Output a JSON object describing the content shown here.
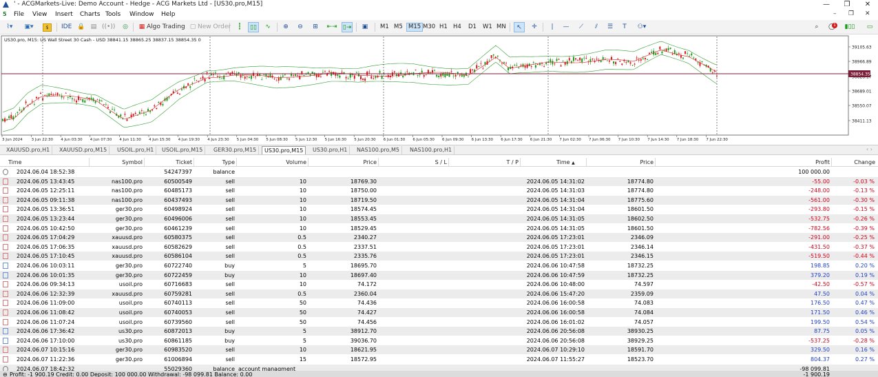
{
  "window": {
    "title": "' - ACGMarkets-Live: Demo Account - Hedge - ACG Markets Ltd - [US30.pro,M15]",
    "minimize": "—",
    "maximize": "❐",
    "close": "✕"
  },
  "menu": [
    "File",
    "View",
    "Insert",
    "Charts",
    "Tools",
    "Window",
    "Help"
  ],
  "toolbar": {
    "ide_label": "IDE",
    "algo_label": "Algo Trading",
    "new_order_label": "New Order",
    "timeframes": [
      "M1",
      "M5",
      "M15",
      "M30",
      "H1",
      "H4",
      "D1",
      "W1",
      "MN"
    ],
    "active_timeframe": "M15",
    "notification_count": "1"
  },
  "chart": {
    "header": "US30.pro, M15:  US Wall Street 30 Cash - USD  38841.15 38865.25 38837.15 38854.35  0",
    "current_price": "38854.35",
    "price_labels": [
      "39105.63",
      "38966.89",
      "38828.17",
      "38689.01",
      "38550.07",
      "38411.13"
    ],
    "time_labels": [
      "3 Jun 2024",
      "3 Jun 22:30",
      "4 Jun 03:30",
      "4 Jun 07:30",
      "4 Jun 11:30",
      "4 Jun 15:30",
      "4 Jun 19:30",
      "4 Jun 23:30",
      "5 Jun 04:30",
      "5 Jun 08:30",
      "5 Jun 12:30",
      "5 Jun 16:30",
      "5 Jun 20:30",
      "6 Jun 01:30",
      "6 Jun 05:30",
      "6 Jun 09:30",
      "6 Jun 13:30",
      "6 Jun 17:30",
      "6 Jun 21:30",
      "7 Jun 02:30",
      "7 Jun 06:30",
      "7 Jun 10:30",
      "7 Jun 14:30",
      "7 Jun 18:30",
      "7 Jun 22:30"
    ],
    "colors": {
      "bull": "#1a9b1a",
      "bear": "#d31a1a",
      "band": "#2e9d2e",
      "price_line": "#7a1f3a"
    }
  },
  "chart_tabs": [
    "XAUUSD.pro,H1",
    "XAUUSD.pro,M15",
    "USOIL.pro,H1",
    "USOIL.pro,M15",
    "GER30.pro,M15",
    "US30.pro,M15",
    "US30.pro,H1",
    "NAS100.pro,M5",
    "NAS100.pro,H1"
  ],
  "active_chart_tab": "US30.pro,M15",
  "history": {
    "headers": {
      "time": "Time",
      "symbol": "Symbol",
      "ticket": "Ticket",
      "type": "Type",
      "volume": "Volume",
      "price": "Price",
      "sl": "S / L",
      "tp": "T / P",
      "close_time": "Time",
      "close_price": "Price",
      "profit": "Profit",
      "change": "Change"
    },
    "sort_marker": "▲",
    "rows": [
      {
        "kind": "balance",
        "time": "2024.06.04 18:52:38",
        "symbol": "",
        "ticket": "54247397",
        "type": "balance",
        "volume": "",
        "price": "",
        "close_time": "",
        "close_price": "",
        "profit": "100 000.00",
        "change": ""
      },
      {
        "kind": "sell",
        "time": "2024.06.05 13:43:45",
        "symbol": "nas100.pro",
        "ticket": "60500549",
        "type": "sell",
        "volume": "10",
        "price": "18769.30",
        "close_time": "2024.06.05 14:31:02",
        "close_price": "18774.80",
        "profit": "-55.00",
        "change": "-0.03 %"
      },
      {
        "kind": "sell",
        "time": "2024.06.05 12:25:11",
        "symbol": "nas100.pro",
        "ticket": "60485173",
        "type": "sell",
        "volume": "10",
        "price": "18750.00",
        "close_time": "2024.06.05 14:31:03",
        "close_price": "18774.80",
        "profit": "-248.00",
        "change": "-0.13 %"
      },
      {
        "kind": "sell",
        "time": "2024.06.05 09:11:38",
        "symbol": "nas100.pro",
        "ticket": "60437493",
        "type": "sell",
        "volume": "10",
        "price": "18719.50",
        "close_time": "2024.06.05 14:31:04",
        "close_price": "18775.60",
        "profit": "-561.00",
        "change": "-0.30 %"
      },
      {
        "kind": "sell",
        "time": "2024.06.05 13:36:51",
        "symbol": "ger30.pro",
        "ticket": "60498924",
        "type": "sell",
        "volume": "10",
        "price": "18574.45",
        "close_time": "2024.06.05 14:31:04",
        "close_price": "18601.50",
        "profit": "-293.80",
        "change": "-0.15 %"
      },
      {
        "kind": "sell",
        "time": "2024.06.05 13:23:44",
        "symbol": "ger30.pro",
        "ticket": "60496006",
        "type": "sell",
        "volume": "10",
        "price": "18553.45",
        "close_time": "2024.06.05 14:31:05",
        "close_price": "18602.50",
        "profit": "-532.75",
        "change": "-0.26 %"
      },
      {
        "kind": "sell",
        "time": "2024.06.05 10:42:50",
        "symbol": "ger30.pro",
        "ticket": "60461239",
        "type": "sell",
        "volume": "10",
        "price": "18529.45",
        "close_time": "2024.06.05 14:31:05",
        "close_price": "18601.50",
        "profit": "-782.56",
        "change": "-0.39 %"
      },
      {
        "kind": "sell",
        "time": "2024.06.05 17:04:29",
        "symbol": "xauusd.pro",
        "ticket": "60580375",
        "type": "sell",
        "volume": "0.5",
        "price": "2340.27",
        "close_time": "2024.06.05 17:23:01",
        "close_price": "2346.09",
        "profit": "-291.00",
        "change": "-0.25 %"
      },
      {
        "kind": "sell",
        "time": "2024.06.05 17:06:35",
        "symbol": "xauusd.pro",
        "ticket": "60582629",
        "type": "sell",
        "volume": "0.5",
        "price": "2337.51",
        "close_time": "2024.06.05 17:23:01",
        "close_price": "2346.14",
        "profit": "-431.50",
        "change": "-0.37 %"
      },
      {
        "kind": "sell",
        "time": "2024.06.05 17:10:45",
        "symbol": "xauusd.pro",
        "ticket": "60586104",
        "type": "sell",
        "volume": "0.5",
        "price": "2335.76",
        "close_time": "2024.06.05 17:23:01",
        "close_price": "2346.15",
        "profit": "-519.50",
        "change": "-0.44 %"
      },
      {
        "kind": "buy",
        "time": "2024.06.06 10:03:11",
        "symbol": "ger30.pro",
        "ticket": "60722740",
        "type": "buy",
        "volume": "5",
        "price": "18695.70",
        "close_time": "2024.06.06 10:47:58",
        "close_price": "18732.25",
        "profit": "198.85",
        "change": "0.20 %"
      },
      {
        "kind": "buy",
        "time": "2024.06.06 10:01:35",
        "symbol": "ger30.pro",
        "ticket": "60722459",
        "type": "buy",
        "volume": "10",
        "price": "18697.40",
        "close_time": "2024.06.06 10:47:59",
        "close_price": "18732.25",
        "profit": "379.20",
        "change": "0.19 %"
      },
      {
        "kind": "sell",
        "time": "2024.06.06 09:34:13",
        "symbol": "usoil.pro",
        "ticket": "60716683",
        "type": "sell",
        "volume": "10",
        "price": "74.172",
        "close_time": "2024.06.06 10:48:00",
        "close_price": "74.597",
        "profit": "-42.50",
        "change": "-0.57 %"
      },
      {
        "kind": "sell",
        "time": "2024.06.06 12:32:39",
        "symbol": "xauusd.pro",
        "ticket": "60759281",
        "type": "sell",
        "volume": "0.5",
        "price": "2360.04",
        "close_time": "2024.06.06 15:47:20",
        "close_price": "2359.09",
        "profit": "47.50",
        "change": "0.04 %"
      },
      {
        "kind": "sell",
        "time": "2024.06.06 11:09:00",
        "symbol": "usoil.pro",
        "ticket": "60740113",
        "type": "sell",
        "volume": "50",
        "price": "74.436",
        "close_time": "2024.06.06 16:00:58",
        "close_price": "74.083",
        "profit": "176.50",
        "change": "0.47 %"
      },
      {
        "kind": "sell",
        "time": "2024.06.06 11:08:42",
        "symbol": "usoil.pro",
        "ticket": "60740053",
        "type": "sell",
        "volume": "50",
        "price": "74.427",
        "close_time": "2024.06.06 16:00:58",
        "close_price": "74.084",
        "profit": "171.50",
        "change": "0.46 %"
      },
      {
        "kind": "sell",
        "time": "2024.06.06 11:07:24",
        "symbol": "usoil.pro",
        "ticket": "60739560",
        "type": "sell",
        "volume": "50",
        "price": "74.456",
        "close_time": "2024.06.06 16:01:02",
        "close_price": "74.057",
        "profit": "199.50",
        "change": "0.54 %"
      },
      {
        "kind": "buy",
        "time": "2024.06.06 17:36:42",
        "symbol": "us30.pro",
        "ticket": "60872013",
        "type": "buy",
        "volume": "5",
        "price": "38912.70",
        "close_time": "2024.06.06 20:56:08",
        "close_price": "38930.25",
        "profit": "87.75",
        "change": "0.05 %"
      },
      {
        "kind": "buy",
        "time": "2024.06.06 17:10:00",
        "symbol": "us30.pro",
        "ticket": "60861185",
        "type": "buy",
        "volume": "5",
        "price": "39036.70",
        "close_time": "2024.06.06 20:56:08",
        "close_price": "38929.25",
        "profit": "-537.25",
        "change": "-0.28 %"
      },
      {
        "kind": "sell",
        "time": "2024.06.07 10:15:16",
        "symbol": "ger30.pro",
        "ticket": "60983520",
        "type": "sell",
        "volume": "10",
        "price": "18621.95",
        "close_time": "2024.06.07 10:29:10",
        "close_price": "18591.70",
        "profit": "329.50",
        "change": "0.16 %"
      },
      {
        "kind": "sell",
        "time": "2024.06.07 11:22:36",
        "symbol": "ger30.pro",
        "ticket": "61006894",
        "type": "sell",
        "volume": "15",
        "price": "18572.95",
        "close_time": "2024.06.07 11:55:27",
        "close_price": "18523.70",
        "profit": "804.37",
        "change": "0.27 %"
      },
      {
        "kind": "balance",
        "time": "2024.06.07 18:42:32",
        "symbol": "",
        "ticket": "55029360",
        "type": "balance",
        "volume": "account managment",
        "price": "",
        "close_time": "",
        "close_price": "",
        "profit": "-98 099.81",
        "change": ""
      }
    ],
    "summary": "Profit: -1 900.19  Credit: 0.00  Deposit: 100 000.00  Withdrawal: -98 099.81  Balance: 0.00",
    "summary_total": "-1 900.19"
  }
}
